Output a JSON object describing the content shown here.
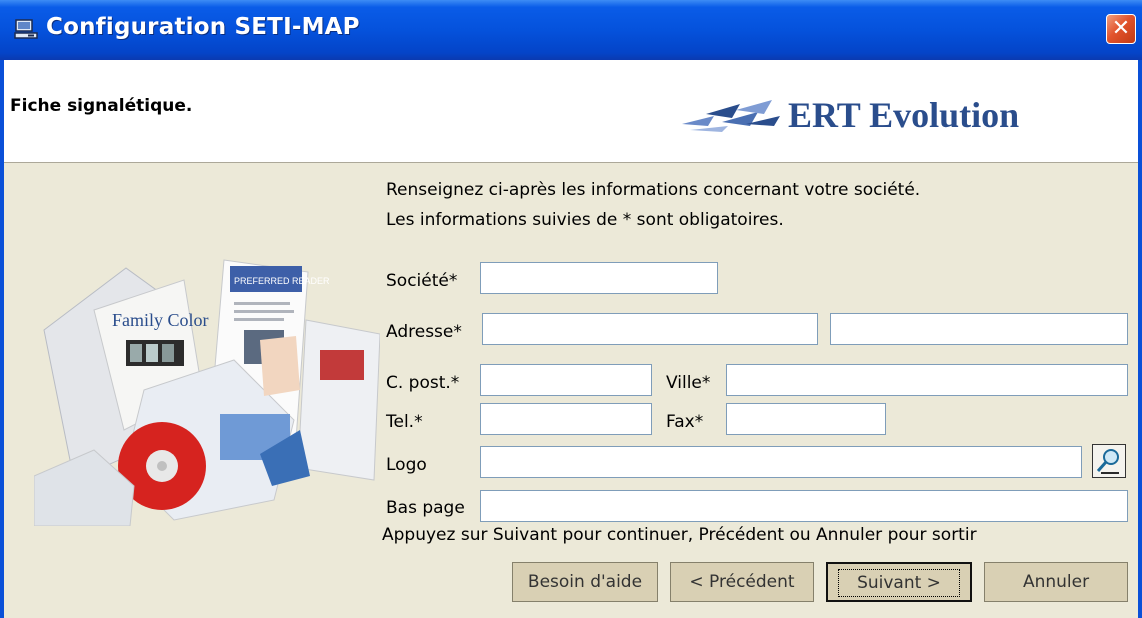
{
  "window": {
    "title": "Configuration SETI-MAP",
    "close_label": "✕"
  },
  "header": {
    "title": "Fiche signalétique.",
    "brand": "ERT Evolution"
  },
  "intro": {
    "line1": "Renseignez ci-après les informations concernant votre société.",
    "line2": "Les informations suivies de * sont obligatoires."
  },
  "form": {
    "societe_label": "Société*",
    "adresse_label": "Adresse*",
    "cpost_label": "C. post.*",
    "ville_label": "Ville*",
    "tel_label": "Tel.*",
    "fax_label": "Fax*",
    "logo_label": "Logo",
    "baspage_label": "Bas page",
    "values": {
      "societe": "",
      "adresse1": "",
      "adresse2": "",
      "cpost": "",
      "ville": "",
      "tel": "",
      "fax": "",
      "logo": "",
      "baspage": ""
    }
  },
  "instruction": "Appuyez sur Suivant pour continuer, Précédent  ou Annuler pour sortir",
  "buttons": {
    "help": "Besoin d'aide",
    "previous": "< Précédent",
    "next": "Suivant >",
    "cancel": "Annuler"
  },
  "icons": {
    "window_icon": "computer-icon",
    "browse_icon": "magnifier-icon"
  },
  "colors": {
    "titlebar": "#0552dc",
    "brand": "#2a4d8c",
    "button_face": "#d9d0b4"
  }
}
